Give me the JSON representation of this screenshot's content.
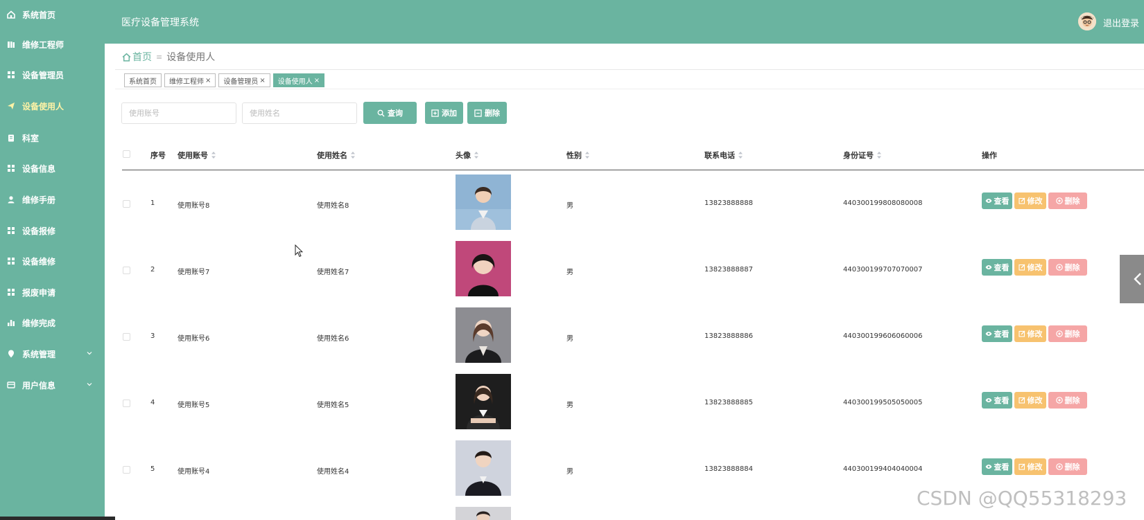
{
  "app": {
    "title": "医疗设备管理系统",
    "logout_label": "退出登录"
  },
  "sidebar": {
    "items": [
      {
        "label": "系统首页",
        "icon": "home-icon"
      },
      {
        "label": "维修工程师",
        "icon": "book-icon"
      },
      {
        "label": "设备管理员",
        "icon": "grid-icon"
      },
      {
        "label": "设备使用人",
        "icon": "send-icon",
        "active": true
      },
      {
        "label": "科室",
        "icon": "clipboard-icon"
      },
      {
        "label": "设备信息",
        "icon": "grid-icon"
      },
      {
        "label": "维修手册",
        "icon": "user-icon"
      },
      {
        "label": "设备报修",
        "icon": "grid-icon"
      },
      {
        "label": "设备维修",
        "icon": "grid-icon"
      },
      {
        "label": "报废申请",
        "icon": "grid-icon"
      },
      {
        "label": "维修完成",
        "icon": "bar-chart-icon"
      },
      {
        "label": "系统管理",
        "icon": "map-pin-icon",
        "has_children": true
      },
      {
        "label": "用户信息",
        "icon": "card-icon",
        "has_children": true
      }
    ],
    "active_color": "#fff3a6"
  },
  "breadcrumb": {
    "home": "首页",
    "separator": "≡",
    "current": "设备使用人"
  },
  "tabs": [
    {
      "label": "系统首页",
      "closable": false
    },
    {
      "label": "维修工程师",
      "closable": true
    },
    {
      "label": "设备管理员",
      "closable": true
    },
    {
      "label": "设备使用人",
      "closable": true,
      "active": true
    }
  ],
  "search": {
    "account_placeholder": "使用账号",
    "name_placeholder": "使用姓名",
    "query_label": "查询",
    "add_label": "添加",
    "delete_label": "删除"
  },
  "table": {
    "headers": {
      "index": "序号",
      "account": "使用账号",
      "name": "使用姓名",
      "avatar": "头像",
      "gender": "性别",
      "phone": "联系电话",
      "id_number": "身份证号",
      "actions": "操作"
    },
    "action_labels": {
      "view": "查看",
      "edit": "修改",
      "delete": "删除"
    },
    "rows": [
      {
        "index": "1",
        "account": "使用账号8",
        "name": "使用姓名8",
        "gender": "男",
        "phone": "13823888888",
        "id_number": "440300199808080008",
        "avatar_bg": "#8fb4d4"
      },
      {
        "index": "2",
        "account": "使用账号7",
        "name": "使用姓名7",
        "gender": "男",
        "phone": "13823888887",
        "id_number": "440300199707070007",
        "avatar_bg": "#c0487a"
      },
      {
        "index": "3",
        "account": "使用账号6",
        "name": "使用姓名6",
        "gender": "男",
        "phone": "13823888886",
        "id_number": "440300199606060006",
        "avatar_bg": "#8d8d92"
      },
      {
        "index": "4",
        "account": "使用账号5",
        "name": "使用姓名5",
        "gender": "男",
        "phone": "13823888885",
        "id_number": "440300199505050005",
        "avatar_bg": "#1e1e1e"
      },
      {
        "index": "5",
        "account": "使用账号4",
        "name": "使用姓名4",
        "gender": "男",
        "phone": "13823888884",
        "id_number": "440300199404040004",
        "avatar_bg": "#cfd3dd"
      }
    ]
  },
  "colors": {
    "primary": "#6ab4a0",
    "warning": "#f7c26f",
    "danger": "#f5a6a6"
  },
  "watermark": "CSDN @QQ55318293"
}
